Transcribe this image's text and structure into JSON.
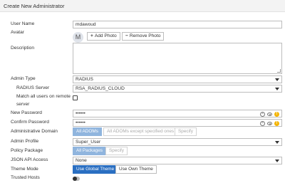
{
  "header": {
    "title": "Create New Administrator"
  },
  "form": {
    "user_name": {
      "label": "User Name",
      "value": "mdawoud"
    },
    "avatar": {
      "label": "Avatar",
      "initial": "M",
      "add_label": "Add Photo",
      "add_glyph": "+",
      "remove_label": "Remove Photo",
      "remove_glyph": "−"
    },
    "description": {
      "label": "Description",
      "value": ""
    },
    "admin_type": {
      "label": "Admin Type",
      "value": "RADIUS"
    },
    "radius_server": {
      "label": "RADIUS Server",
      "value": "RSA_RADIUS_CLOUD"
    },
    "match_all": {
      "label_line1": "Match all users on remote",
      "label_line2": "server",
      "checked": false
    },
    "new_password": {
      "label": "New Password",
      "value": "••••••"
    },
    "confirm_password": {
      "label": "Confirm Password",
      "value": "••••••"
    },
    "admin_domain": {
      "label": "Administrative Domain",
      "options": [
        "All ADOMs",
        "All ADOMs except specified ones",
        "Specify"
      ],
      "selected": "All ADOMs"
    },
    "admin_profile": {
      "label": "Admin Profile",
      "value": "Super_User"
    },
    "policy_package": {
      "label": "Policy Package",
      "options": [
        "All Packages",
        "Specify"
      ],
      "selected": "All Packages"
    },
    "json_api": {
      "label": "JSON API Access",
      "value": "None"
    },
    "theme_mode": {
      "label": "Theme Mode",
      "options": [
        "Use Global Theme",
        "Use Own Theme"
      ],
      "selected": "Use Global Theme"
    },
    "trusted_hosts": {
      "label": "Trusted Hosts",
      "enabled": false
    }
  },
  "icons": {
    "clear": "clear-icon",
    "eye": "eye-icon",
    "warning": "warning-icon",
    "caret": "chevron-down-icon"
  },
  "colors": {
    "primary": "#2a6fc2",
    "segment_active": "#90b5de",
    "warning": "#f4b400",
    "header_bg": "#f3f3f3"
  }
}
